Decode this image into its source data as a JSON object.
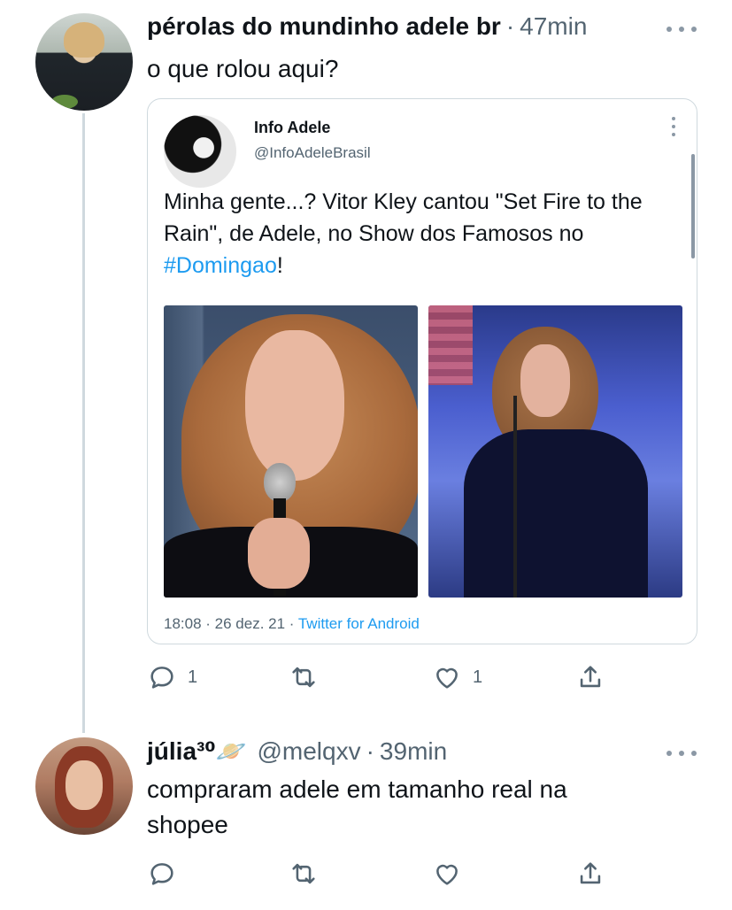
{
  "tweets": [
    {
      "display_name": "pérolas do mundinho adele br",
      "handle": "",
      "time": "47min",
      "text": "o que rolou aqui?",
      "avatar_icon": "avatar-photo",
      "actions": {
        "reply_count": "1",
        "retweet_count": "",
        "like_count": "1"
      }
    },
    {
      "display_name": "júlia³⁰🪐",
      "handle": "@melqxv",
      "time": "39min",
      "text": "compraram adele em tamanho real na shopee",
      "avatar_icon": "avatar-photo",
      "actions": {
        "reply_count": "",
        "retweet_count": "",
        "like_count": ""
      }
    }
  ],
  "quote": {
    "name": "Info Adele",
    "handle": "@InfoAdeleBrasil",
    "text_before": "Minha gente...? Vitor Kley cantou \"Set Fire to the Rain\", de Adele, no Show dos Famosos no ",
    "hashtag": "#Domingao",
    "text_after": "!",
    "timestamp": "18:08 · 26 dez. 21 · ",
    "source": "Twitter for Android",
    "images": [
      "performer-closeup-photo",
      "performer-stage-photo"
    ]
  },
  "colors": {
    "link": "#1d9bf0",
    "secondary_text": "#536471",
    "border": "#cfd9de",
    "primary_text": "#0f1419"
  },
  "icons": [
    "more-icon",
    "reply-icon",
    "retweet-icon",
    "like-icon",
    "share-icon"
  ]
}
